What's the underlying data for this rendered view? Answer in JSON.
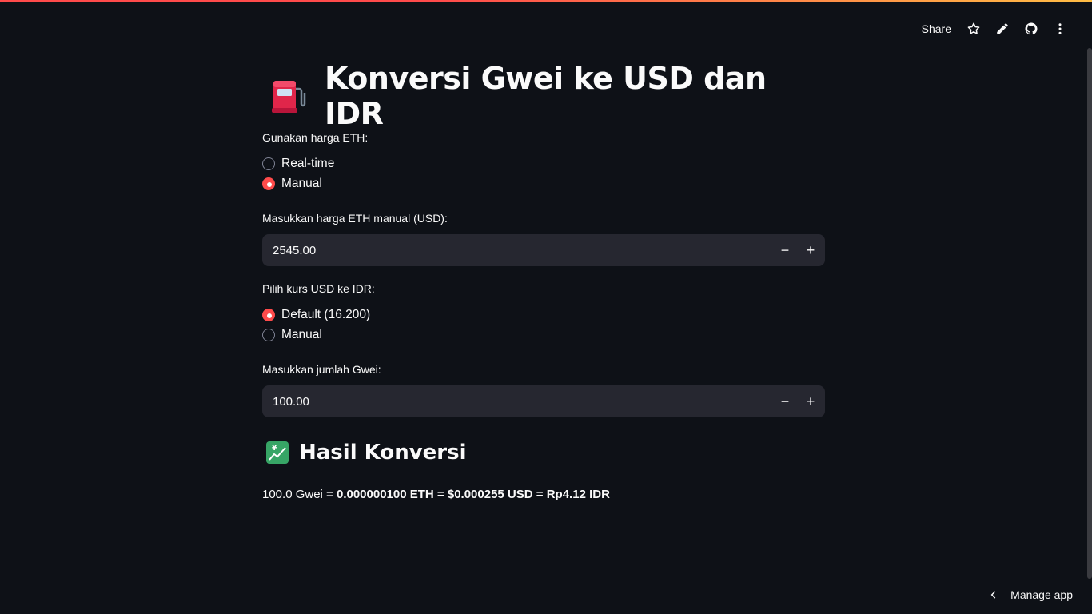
{
  "header": {
    "share_label": "Share",
    "icons": [
      "star-icon",
      "pencil-icon",
      "github-icon",
      "more-vertical-icon"
    ]
  },
  "colors": {
    "background": "#0e1117",
    "accent": "#ff4b4b",
    "input_bg": "#262730",
    "text": "#fafafa"
  },
  "title": {
    "emoji_icon": "fuel-pump-icon",
    "text": "Konversi Gwei ke USD dan IDR"
  },
  "eth_price": {
    "label": "Gunakan harga ETH:",
    "options": [
      "Real-time",
      "Manual"
    ],
    "selected": "Manual"
  },
  "eth_manual": {
    "label": "Masukkan harga ETH manual (USD):",
    "value": "2545.00"
  },
  "rate": {
    "label": "Pilih kurs USD ke IDR:",
    "options": [
      "Default (16.200)",
      "Manual"
    ],
    "selected": "Default (16.200)"
  },
  "gwei": {
    "label": "Masukkan jumlah Gwei:",
    "value": "100.00"
  },
  "result": {
    "emoji_icon": "chart-yen-icon",
    "heading": "Hasil Konversi",
    "prefix": "100.0 Gwei = ",
    "eth": "0.000000100 ETH",
    "sep1": " = ",
    "usd": "$0.000255 USD",
    "sep2": " = ",
    "idr": "Rp4.12 IDR"
  },
  "footer": {
    "manage_label": "Manage app"
  }
}
